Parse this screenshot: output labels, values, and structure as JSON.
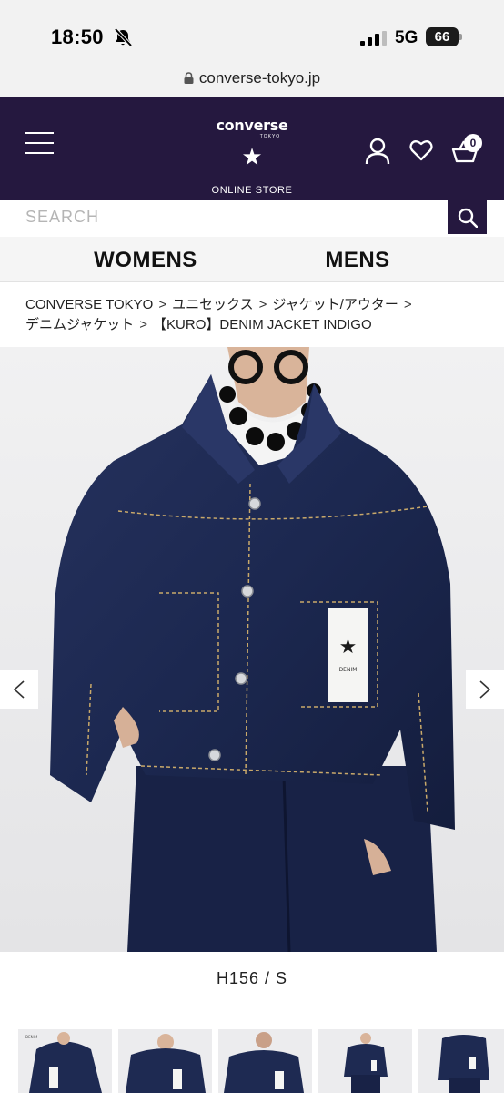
{
  "status_bar": {
    "time": "18:50",
    "network": "5G",
    "battery": "66"
  },
  "browser": {
    "url": "converse-tokyo.jp"
  },
  "header": {
    "logo_text": "converse",
    "logo_subtext": "TOKYO",
    "store_label": "ONLINE STORE",
    "cart_count": "0"
  },
  "search": {
    "placeholder": "SEARCH"
  },
  "nav": {
    "womens": "WOMENS",
    "mens": "MENS"
  },
  "breadcrumb": {
    "items": [
      "CONVERSE TOKYO",
      "ユニセックス",
      "ジャケット/アウター",
      "デニムジャケット",
      "【KURO】DENIM JACKET INDIGO"
    ],
    "separator": ">"
  },
  "product": {
    "pocket_label": "DENIM",
    "size_caption": "H156 / S",
    "thumbnail_count": 5,
    "thumbnail_label": "DENIM"
  },
  "colors": {
    "brand_navy": "#25183f",
    "denim": "#1e2a52",
    "stitch": "#c9a96a"
  }
}
